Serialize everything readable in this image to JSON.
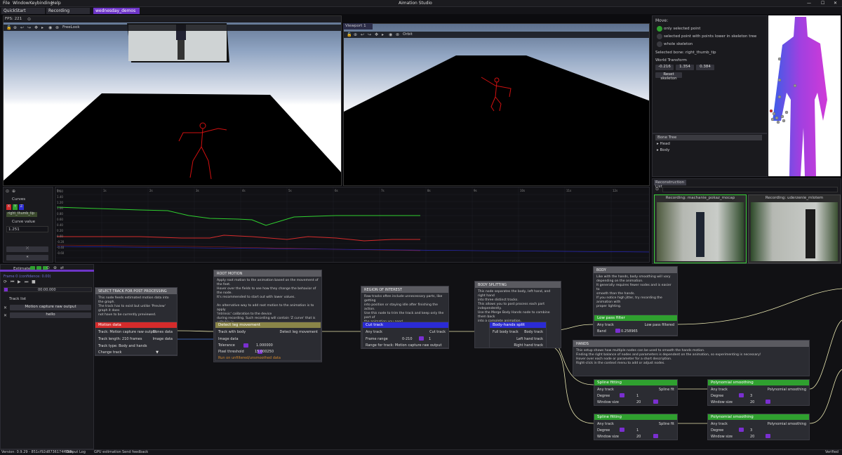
{
  "app": {
    "title": "Aimation Studio"
  },
  "menu": [
    "File",
    "Window",
    "Keybinding",
    "Help"
  ],
  "window_controls": {
    "minimize": "—",
    "maximize": "☐",
    "close": "✕"
  },
  "tabs": [
    {
      "label": "QuickStart"
    },
    {
      "label": "Recording"
    },
    {
      "label": "wednesday_demos",
      "active": true
    }
  ],
  "viewport_left": {
    "fps": "FPS: 221",
    "mode": "FreeLook"
  },
  "viewport_right": {
    "tab": "Viewport 1",
    "mode": "Orbit"
  },
  "move_panel": {
    "title": "Move:",
    "options": [
      {
        "label": "only selected point",
        "selected": true
      },
      {
        "label": "selected point with points lower in skeleton tree",
        "selected": false
      },
      {
        "label": "whole skeleton",
        "selected": false
      }
    ],
    "selected_bone": "Selected bone: right_thumb_tip",
    "world_transform": "World Transform",
    "transform_values": [
      "-0.216",
      "1.354",
      "0.384"
    ],
    "reset": "Reset skeleton"
  },
  "bone_tree": {
    "title": "Bone Tree",
    "items": [
      "Head",
      "Body"
    ]
  },
  "reconstruction": {
    "title": "Reconstruction List",
    "items": [
      {
        "label": "Recording: machanie_pokaz_mocap"
      },
      {
        "label": "Recording: uderzenie_mlotem"
      }
    ]
  },
  "curves": {
    "label": "Curves",
    "axes": [
      "X",
      "Y",
      "Z"
    ],
    "bone": "right_thumb_tip",
    "value_label": "Curve value",
    "value": "1.251",
    "y_ticks": [
      "1.60",
      "1.40",
      "1.20",
      "1.00",
      "0.80",
      "0.60",
      "0.40",
      "0.20",
      "0.00",
      "-0.20",
      "-0.40",
      "-0.60"
    ],
    "x_ticks": [
      "0s",
      "1s",
      "2s",
      "3s",
      "4s",
      "5s",
      "6s",
      "7s",
      "8s",
      "9s",
      "10s",
      "11s",
      "12s",
      "13s"
    ]
  },
  "estimate": {
    "label": "Estimate",
    "frame": "Frame 0 (confidence: 0.00)",
    "time": "00:00.000",
    "track_list": "Track list",
    "tracks": [
      "Motion capture raw output",
      "hello"
    ]
  },
  "colors": {
    "accent": "#6d35c7",
    "red": "#d42b2b",
    "yellow": "#8a8548",
    "blue": "#2b2bd4",
    "green": "#2fa02f"
  },
  "groups": {
    "select": {
      "title": "SELECT TRACK FOR POST PROCESSING",
      "text": [
        "This node feeds estimated motion data into the graph.",
        "The track has to exist but unlike 'Preview' graph it does",
        "not have to be currently previewed."
      ]
    },
    "root": {
      "title": "ROOT MOTION",
      "text": [
        "Apply root motion to the animation based on the movement of the feet.",
        "Hover over the fields to see how they change the behavior of the node.",
        "It's recommended to start out with lower values.",
        "",
        "An alternative way to add root motion to the animation is to apply",
        "'Intrinsic' calibration to the device",
        "during recording. Such recording will contain 'Z curve' that is editable in",
        "curve editor."
      ]
    },
    "region": {
      "title": "REGION OF INTEREST",
      "text": [
        "Raw tracks often include unnecessary parts, like getting",
        "into position or staying idle after finishing the action.",
        "Use this node to trim the track and keep only the part of",
        "the animation you need."
      ]
    },
    "body_split": {
      "title": "BODY SPLITTING",
      "text": [
        "This node separates the body, left hand, and right hand",
        "into three distinct tracks.",
        "This allows you to post process each part independently.",
        "Use the Merge Body Hands node to combine them back",
        "into a complete animation."
      ]
    },
    "body": {
      "title": "BODY",
      "text": [
        "Like with the hands, body smoothing will vary",
        "depending on the animation.",
        "It generally requires fewer nodes and is easier to",
        "smooth than the hands.",
        "If you notice high jitter, try recording the animation with",
        "proper lighting."
      ]
    },
    "hands": {
      "title": "HANDS",
      "text": [
        "This setup shows how multiple nodes can be used to smooth the hands motion.",
        "Finding the right balance of nodes and parameters is dependent on the animation, so experimenting is necessary!",
        "Hover over each node or parameter for a short description.",
        "Right-click in the context menu to add or adjust nodes."
      ]
    }
  },
  "nodes": {
    "motion": {
      "title": "Motion data",
      "track": "Track: Motion capture raw output",
      "length": "Track length: 210 frames",
      "type": "Track type: Body and hands",
      "bones_out": "Bones data",
      "image_out": "Image data",
      "change": "Change track"
    },
    "detect": {
      "title": "Detect leg movement",
      "in1": "Track with body",
      "in2": "Image data",
      "out": "Detect leg movement",
      "tolerance_label": "Tolerance",
      "tolerance": "1.000000",
      "pixel_label": "Pixel threshold",
      "pixel": "15.000250",
      "warning": "Run on unfiltered/unsmoothed data"
    },
    "cut": {
      "title": "Cut track",
      "in": "Any track",
      "out": "Cut track",
      "range_label": "Frame range",
      "range_min": "0-210",
      "range_max": "1",
      "info": "Range for track: Motion capture raw output"
    },
    "split": {
      "title": "Body-hands split",
      "in": "Full body track",
      "body": "Body track",
      "left": "Left hand track",
      "right": "Right hand track"
    },
    "lowpass": {
      "title": "Low pass filter",
      "in": "Any track",
      "out": "Low pass filtered",
      "band_label": "Band",
      "band": "0.258965"
    },
    "spline1": {
      "title": "Spline fitting",
      "in": "Any track",
      "out": "Spline fit",
      "degree_label": "Degree",
      "degree": "1",
      "window_label": "Window size",
      "window": "20"
    },
    "poly1": {
      "title": "Polynomial smoothing",
      "in": "Any track",
      "out": "Polynomial smoothing",
      "degree_label": "Degree",
      "degree": "3",
      "window_label": "Window size",
      "window": "20"
    },
    "spline2": {
      "title": "Spline fitting",
      "in": "Any track",
      "out": "Spline fit",
      "degree_label": "Degree",
      "degree": "1",
      "window_label": "Window size",
      "window": "20"
    },
    "poly2": {
      "title": "Polynomial smoothing",
      "in": "Any track",
      "out": "Polynomial smoothing",
      "degree_label": "Degree",
      "degree": "3",
      "window_label": "Window size",
      "window": "20"
    }
  },
  "status": {
    "version": "Version: 0.9.29 - 851cf92d8736174f668c",
    "output": "Output Log",
    "gpu": "GPU estimation",
    "feedback": "Send feedback",
    "verified": "Verified"
  }
}
